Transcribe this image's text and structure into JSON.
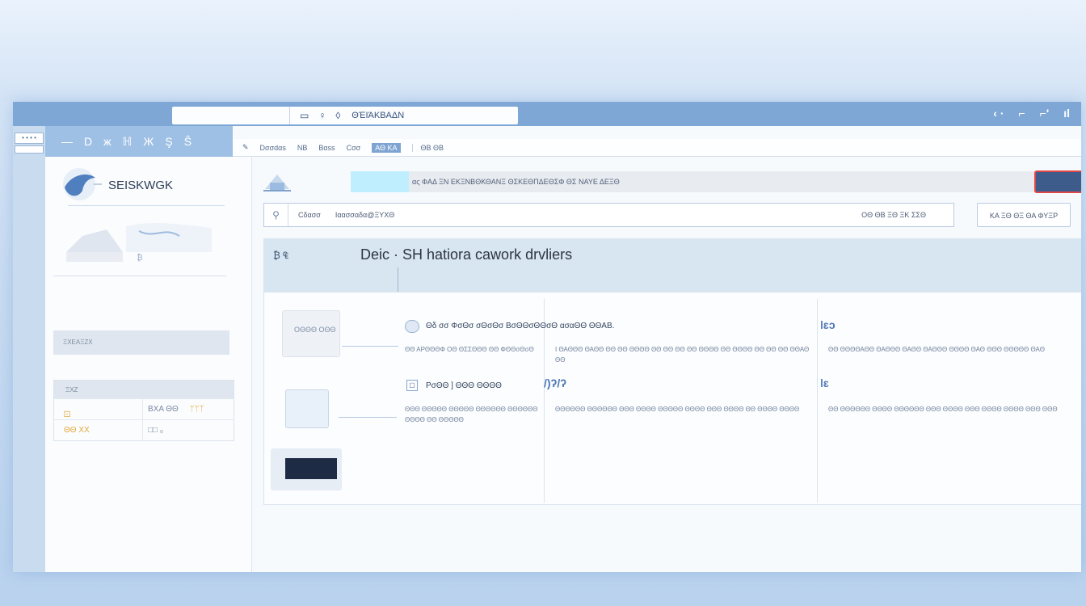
{
  "titlebar": {
    "address_text": "ΘΈΙΆΚΒΑΔΝ",
    "address_icons": [
      "window-icon",
      "pin-icon",
      "drop-icon"
    ],
    "right_icons": [
      "back-icon",
      "lock-icon",
      "share-icon",
      "bars-icon"
    ]
  },
  "window_controls": {
    "dots": "• • • •"
  },
  "nav": {
    "items": [
      "—",
      "D",
      "ж",
      "ℍ",
      "Ж",
      "Ş",
      "Ŝ"
    ]
  },
  "sidebar": {
    "logo_text": "SEISKWGK",
    "box_label": "₿",
    "gray_bar_text": "ΞΧΕΑΞΖΧ",
    "table": {
      "header": "ΞΧΖ",
      "rows": [
        {
          "c1": "🝕",
          "c2": "ΒΧΑ ΘΘ",
          "c3": "ᛘᛘᛉ"
        },
        {
          "c1": "ΘΘ ΧΧ",
          "c2": "□□ ₀",
          "c3": ""
        }
      ]
    }
  },
  "crumbs": {
    "items": [
      "Dσσdαs",
      "ΝΒ",
      "Bαss",
      "Cσσ"
    ],
    "pill": "ΑΘ ΚΑ",
    "end": "ΘΒ ΘΒ"
  },
  "banner": {
    "text": "ας ΦΑΔ ΞΝ ΕΚΞΝΒΘΚΘΑΝΞ ΘΣΚΕΘΠΔΕΘΣΦ ΘΣ ΝΑΥΕ ΔΕΞΘ"
  },
  "search": {
    "label": "Cδασσ",
    "value": "Ιαασσαδα@ΞΥΧΘ",
    "right_text": "ΟΘ ΘΒ ΞΘ ΞΚ ΣΣΘ",
    "action_label": "ΚΑ ΞΘ ΘΞ ΘΑ ΦΥΞΡ"
  },
  "section": {
    "icons": "₿ ₠",
    "title": "Deic · SH hatiora cawork drvliers"
  },
  "cards": {
    "thumb_label": "ΟΘΘΘ\nΟΘΘ",
    "card1_title": "Θδ σσ ΦσΘσ σΘσΘσ ΒσΘΘσΘΘσΘ ασαΘΘ ΘΘΑΒ.",
    "card1_text": "ΘΘ ΑΡΘΘΘΦ ΟΘ ΘΣΣΘΘΘ ΘΘ ΦΘΘσΘσΘ",
    "card2_text": "Ι ΘΑΘΘΘ ΘΑΘΘ ΘΘ ΘΘ ΘΘΘΘ ΘΘ ΘΘ ΘΘ ΘΘ ΘΘΘΘ ΘΘ ΘΘΘΘ ΘΘ ΘΘ ΘΘ ΘΘΑΘ ΘΘ",
    "card3_icon": "ǀɛɔ",
    "card3_text": "ΘΘ ΘΘΘΘΑΘΘ ΘΑΘΘΘ ΘΑΘΘ ΘΑΘΘΘ ΘΘΘΘ ΘΑΘ ΘΘΘ ΘΘΘΘΘ ΘΑΘ",
    "card4_title": "ΡσΘΘ ] ΘΘΘ ΘΘΘΘ",
    "card4_text": "ΘΘΘ ΘΘΘΘΘ ΘΘΘΘΘ ΘΘΘΘΘΘ ΘΘΘΘΘΘ ΘΘΘΘ ΘΘ ΘΘΘΘΘ",
    "card5_icon": "/)ʔ/ʔ",
    "card5_text": "ΘΘΘΘΘΘ ΘΘΘΘΘΘ ΘΘΘ ΘΘΘΘ ΘΘΘΘΘ ΘΘΘΘ ΘΘΘ ΘΘΘΘ ΘΘ ΘΘΘΘ ΘΘΘΘ",
    "card6_icon": "ǀɛ",
    "card6_text": "ΘΘ ΘΘΘΘΘΘ ΘΘΘΘ ΘΘΘΘΘΘ ΘΘΘ ΘΘΘΘ ΘΘΘ ΘΘΘΘ ΘΘΘΘ ΘΘΘ ΘΘΘ"
  },
  "colors": {
    "titlebar": "#7ea7d6",
    "accent_button": "#3d5c8c",
    "accent_button_border": "#e04848",
    "band": "#d7e6f1"
  }
}
